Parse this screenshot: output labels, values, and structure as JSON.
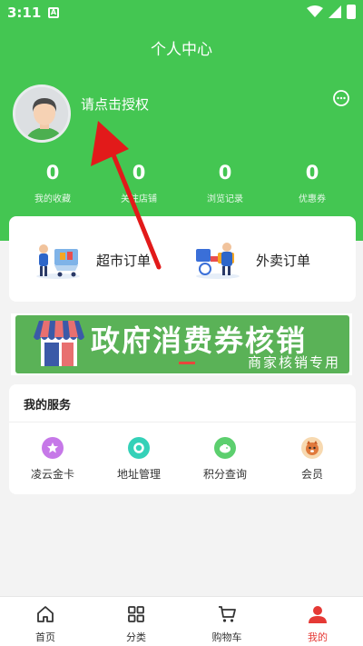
{
  "status_bar": {
    "time": "3:11",
    "notif": "A"
  },
  "header": {
    "title": "个人中心",
    "auth_prompt": "请点击授权"
  },
  "stats": [
    {
      "value": "0",
      "label": "我的收藏"
    },
    {
      "value": "0",
      "label": "关注店铺"
    },
    {
      "value": "0",
      "label": "浏览记录"
    },
    {
      "value": "0",
      "label": "优惠券"
    }
  ],
  "orders": [
    {
      "label": "超市订单",
      "icon": "supermarket-cart-icon"
    },
    {
      "label": "外卖订单",
      "icon": "delivery-icon"
    }
  ],
  "banner": {
    "title": "政府消费券核销",
    "subtitle": "商家核销专用"
  },
  "services": {
    "title": "我的服务",
    "items": [
      {
        "label": "凌云金卡",
        "icon": "gold-card-icon",
        "color": "#c678e8"
      },
      {
        "label": "地址管理",
        "icon": "location-icon",
        "color": "#34d1b8"
      },
      {
        "label": "积分查询",
        "icon": "piggy-bank-icon",
        "color": "#5ccf6e"
      },
      {
        "label": "会员",
        "icon": "member-icon",
        "color": "#e07a3c"
      }
    ]
  },
  "tabs": [
    {
      "label": "首页",
      "icon": "home-icon"
    },
    {
      "label": "分类",
      "icon": "grid-icon"
    },
    {
      "label": "购物车",
      "icon": "cart-icon"
    },
    {
      "label": "我的",
      "icon": "user-icon",
      "active": true
    }
  ],
  "colors": {
    "brand_green": "#44c652",
    "active_red": "#e53935",
    "arrow_red": "#e21a1a"
  }
}
